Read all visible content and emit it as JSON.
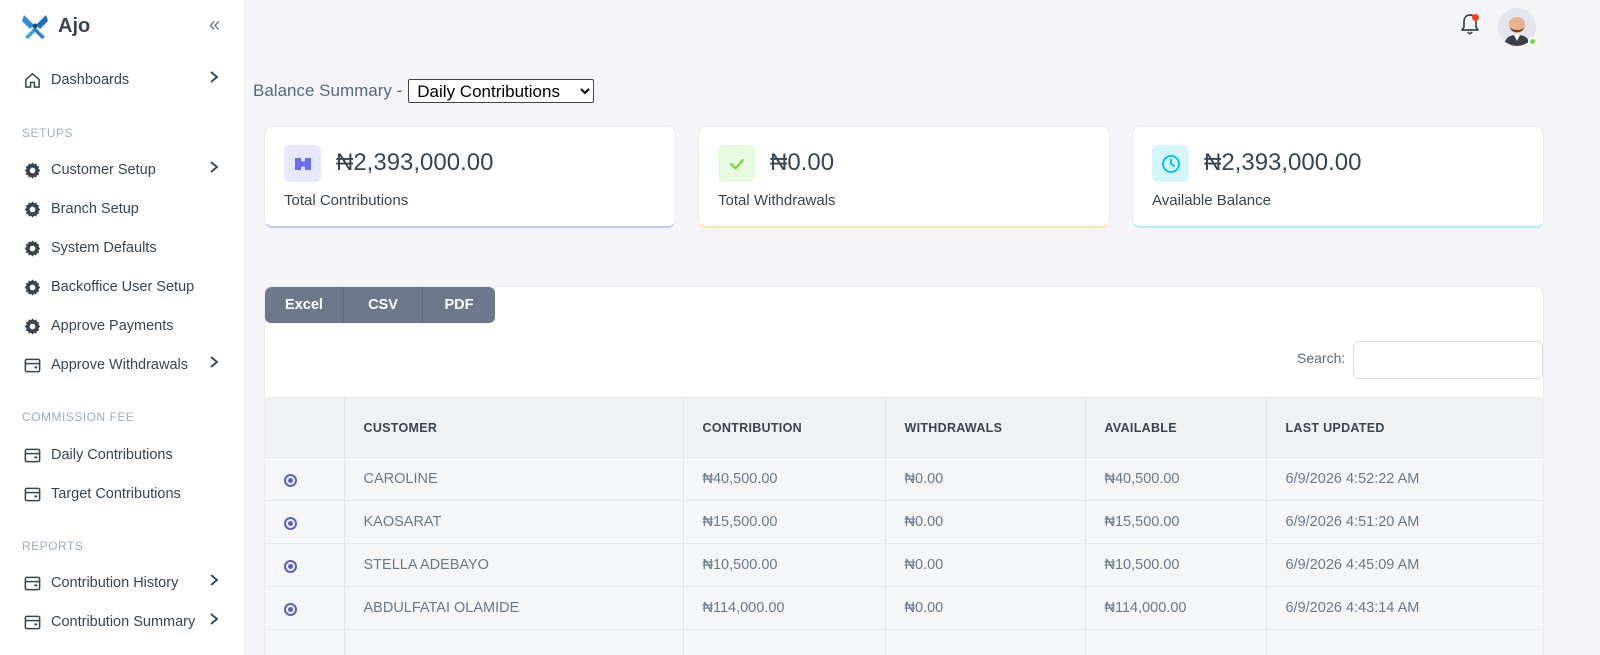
{
  "app": {
    "name": "Ajo"
  },
  "sidebar": {
    "dashboards": "Dashboards",
    "sections": {
      "setups": "SETUPS",
      "commission": "COMMISSION FEE",
      "reports": "REPORTS"
    },
    "setups": [
      "Customer Setup",
      "Branch Setup",
      "System Defaults",
      "Backoffice User Setup",
      "Approve Payments",
      "Approve Withdrawals"
    ],
    "commission": [
      "Daily Contributions",
      "Target Contributions"
    ],
    "reports": [
      "Contribution History",
      "Contribution Summary"
    ]
  },
  "summary": {
    "label": "Balance Summary -",
    "selected": "Daily Contributions"
  },
  "cards": [
    {
      "amount": "₦2,393,000.00",
      "label": "Total Contributions",
      "color": "#696cff"
    },
    {
      "amount": "₦0.00",
      "label": "Total Withdrawals",
      "color": "#71dd37"
    },
    {
      "amount": "₦2,393,000.00",
      "label": "Available Balance",
      "color": "#03c3ec"
    }
  ],
  "export": {
    "excel": "Excel",
    "csv": "CSV",
    "pdf": "PDF"
  },
  "search": {
    "label": "Search:",
    "value": ""
  },
  "table": {
    "headers": [
      "CUSTOMER",
      "CONTRIBUTION",
      "WITHDRAWALS",
      "AVAILABLE",
      "LAST UPDATED"
    ],
    "rows": [
      [
        "CAROLINE",
        "₦40,500.00",
        "₦0.00",
        "₦40,500.00",
        "6/9/2026 4:52:22 AM"
      ],
      [
        "KAOSARAT",
        "₦15,500.00",
        "₦0.00",
        "₦15,500.00",
        "6/9/2026 4:51:20 AM"
      ],
      [
        "STELLA ADEBAYO",
        "₦10,500.00",
        "₦0.00",
        "₦10,500.00",
        "6/9/2026 4:45:09 AM"
      ],
      [
        "ABDULFATAI OLAMIDE",
        "₦114,000.00",
        "₦0.00",
        "₦114,000.00",
        "6/9/2026 4:43:14 AM"
      ],
      [
        "",
        "",
        "",
        "",
        ""
      ]
    ]
  }
}
